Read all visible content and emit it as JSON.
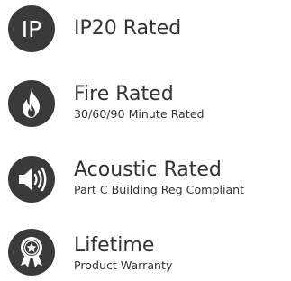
{
  "colors": {
    "badge_bg": "#3a3a3a",
    "badge_fg": "#ffffff",
    "text": "#333333"
  },
  "features": [
    {
      "icon": "ip-rating-icon",
      "badge_text": "IP",
      "title": "IP20 Rated",
      "subtitle": ""
    },
    {
      "icon": "flame-icon",
      "title": "Fire Rated",
      "subtitle": "30/60/90 Minute Rated"
    },
    {
      "icon": "speaker-icon",
      "title": "Acoustic Rated",
      "subtitle": "Part C Building Reg Compliant"
    },
    {
      "icon": "award-rosette-icon",
      "title": "Lifetime",
      "subtitle": "Product Warranty"
    }
  ]
}
